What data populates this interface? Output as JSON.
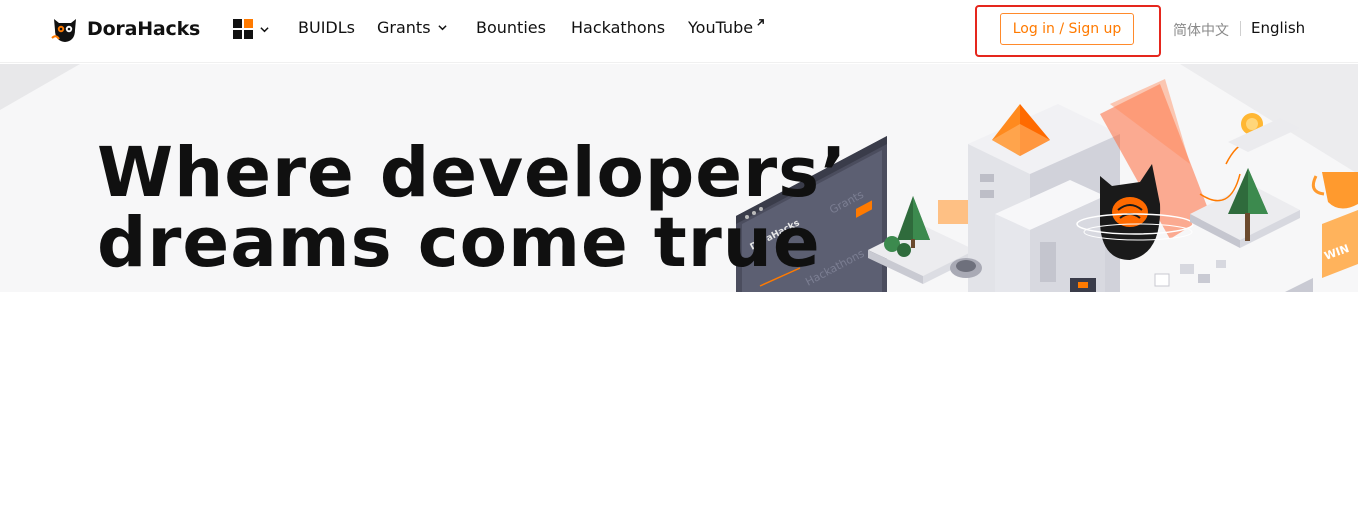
{
  "brand": {
    "name": "DoraHacks"
  },
  "nav": {
    "links": [
      {
        "label": "BUIDLs"
      },
      {
        "label": "Grants"
      },
      {
        "label": "Bounties"
      },
      {
        "label": "Hackathons"
      },
      {
        "label": "YouTube"
      }
    ]
  },
  "auth": {
    "login_label": "Log in / Sign up"
  },
  "lang": {
    "chinese": "简体中文",
    "english": "English"
  },
  "hero": {
    "title_line1": "Where developers’",
    "title_line2": "dreams come true"
  },
  "illustration": {
    "screen_logo": "DoraHacks",
    "screen_label1": "Grants",
    "screen_label2": "Hackathons",
    "trophy_badge": "WIN"
  },
  "colors": {
    "accent": "#ff7a00",
    "highlight": "#e5261d",
    "hero_bg": "#f7f7f8"
  }
}
